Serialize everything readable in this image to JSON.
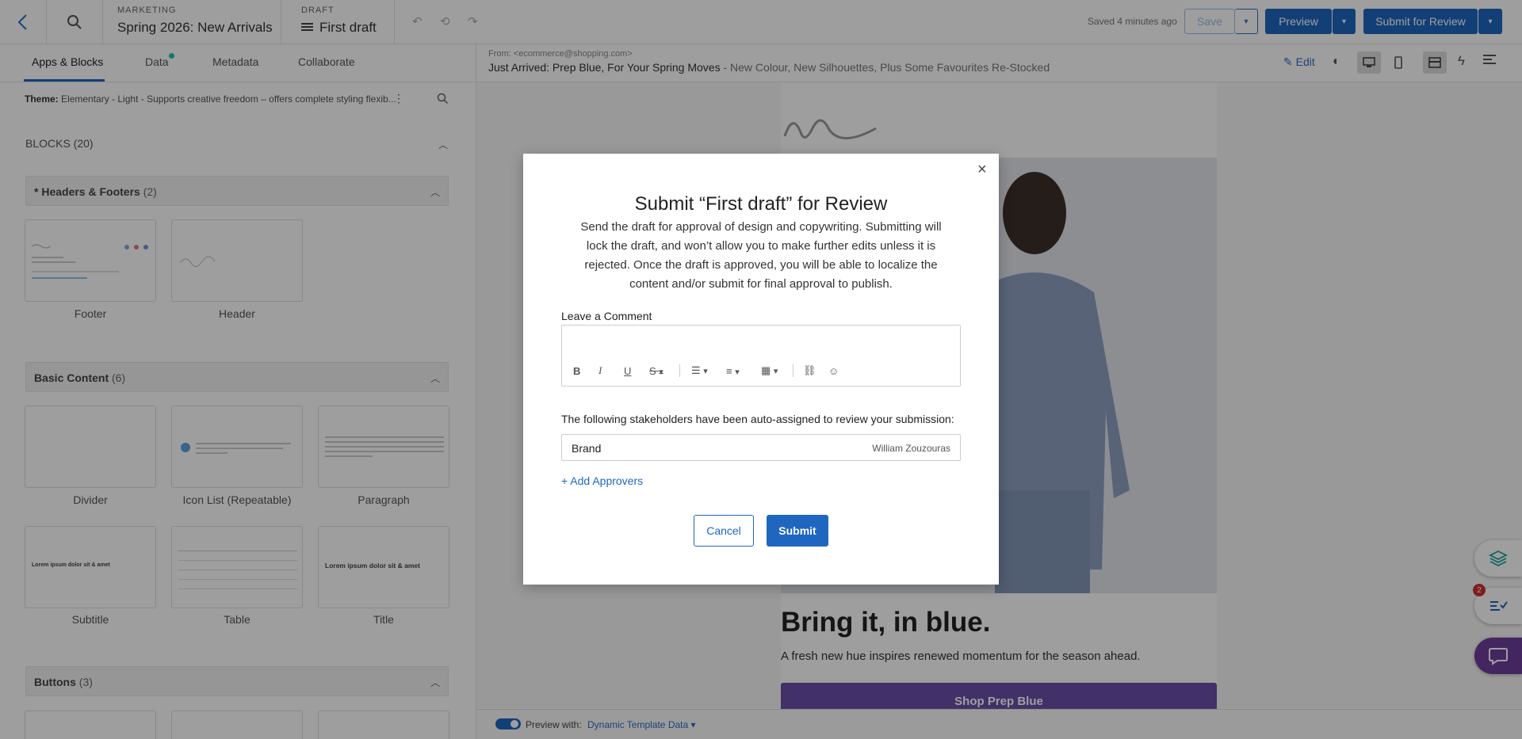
{
  "topbar": {
    "section1_label": "MARKETING",
    "section1_value": "Spring 2026: New Arrivals",
    "section2_label": "DRAFT",
    "section2_value": "First draft",
    "saved": "Saved 4 minutes ago",
    "save": "Save",
    "preview": "Preview",
    "submit_review": "Submit for Review"
  },
  "panel_tabs": [
    "Apps & Blocks",
    "Data",
    "Metadata",
    "Collaborate"
  ],
  "theme": {
    "label": "Theme:",
    "value": "Elementary - Light - Supports creative freedom – offers complete styling flexib..."
  },
  "blocks": {
    "title": "BLOCKS (20)",
    "groups": [
      {
        "name": "* Headers & Footers",
        "count": "(2)",
        "items": [
          "Footer",
          "Header"
        ]
      },
      {
        "name": "Basic Content",
        "count": "(6)",
        "items": [
          "Divider",
          "Icon List (Repeatable)",
          "Paragraph",
          "Subtitle",
          "Table",
          "Title"
        ]
      },
      {
        "name": "Buttons",
        "count": "(3)",
        "items": []
      }
    ],
    "thumb_text": {
      "lorem_bold": "Lorem ipsum dolor sit & amet"
    }
  },
  "email": {
    "from_label": "From:",
    "from_value": "<ecommerce@shopping.com>",
    "subject": "Just Arrived: Prep Blue, For Your Spring Moves",
    "preheader": " - New Colour, New Silhouettes, Plus Some Favourites Re-Stocked",
    "edit": "Edit",
    "headline": "Bring it, in blue.",
    "body": "A fresh new hue inspires renewed momentum for the season ahead.",
    "cta": "Shop Prep Blue"
  },
  "bottom": {
    "preview_with": "Preview with:",
    "source": "Dynamic Template Data"
  },
  "modal": {
    "title": "Submit “First draft” for Review",
    "description": "Send the draft for approval of design and copywriting. Submitting will lock the draft, and won’t allow you to make further edits unless it is rejected. Once the draft is approved, you will be able to localize the content and/or submit for final approval to publish.",
    "comment_label": "Leave a Comment",
    "comment_value": "",
    "stakeholders_text": "The following stakeholders have been auto-assigned to review your submission:",
    "approver_role": "Brand",
    "approver_name": "William Zouzouras",
    "add_approvers": "+ Add Approvers",
    "cancel": "Cancel",
    "submit": "Submit"
  },
  "fab": {
    "notifications_badge": "2"
  },
  "colors": {
    "accent": "#1f66c1",
    "link": "#2b6fc7",
    "cta_purple": "#6a4fa8",
    "teal_dot": "#1ec2b8",
    "badge_red": "#d0302f"
  }
}
